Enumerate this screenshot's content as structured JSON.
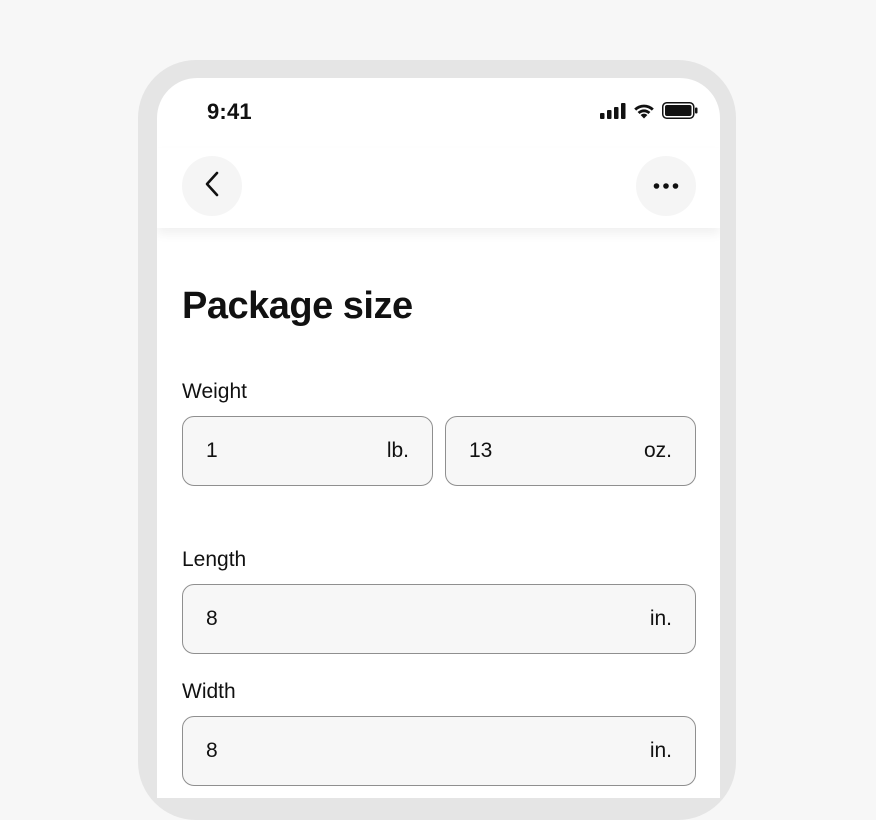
{
  "status_bar": {
    "time": "9:41",
    "icons": [
      "cellular-signal-icon",
      "wifi-icon",
      "battery-icon"
    ]
  },
  "nav": {
    "back_icon": "chevron-left-icon",
    "more_icon": "more-horizontal-icon"
  },
  "page": {
    "title": "Package size"
  },
  "weight": {
    "label": "Weight",
    "pounds": {
      "value": "1",
      "unit": "lb."
    },
    "ounces": {
      "value": "13",
      "unit": "oz."
    }
  },
  "length": {
    "label": "Length",
    "value": "8",
    "unit": "in."
  },
  "width": {
    "label": "Width",
    "value": "8",
    "unit": "in."
  },
  "colors": {
    "background": "#f7f7f7",
    "frame": "#e5e5e5",
    "field_border": "#8f8f8f",
    "text": "#111111"
  }
}
